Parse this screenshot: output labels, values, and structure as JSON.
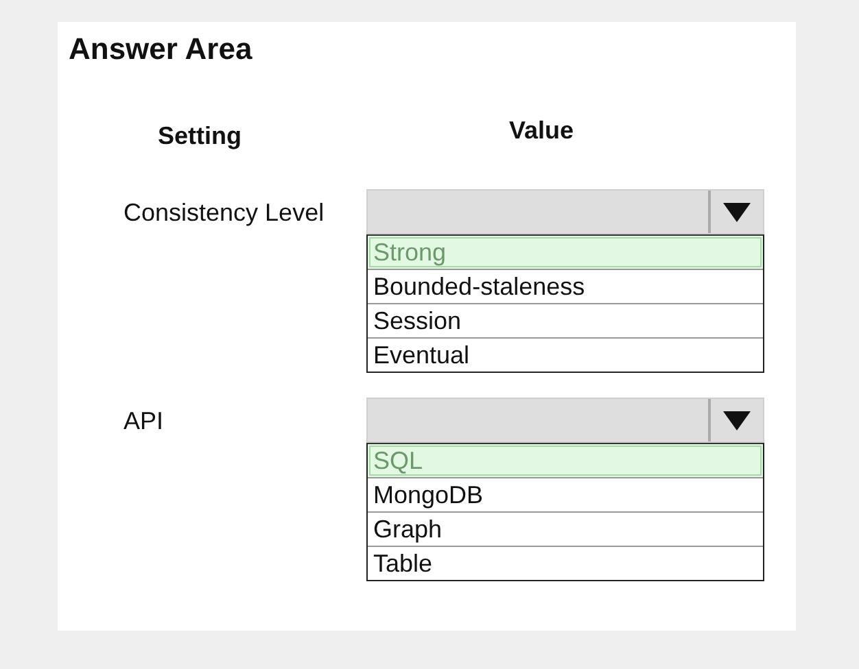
{
  "title": "Answer Area",
  "headers": {
    "setting": "Setting",
    "value": "Value"
  },
  "rows": [
    {
      "label": "Consistency Level",
      "options": [
        {
          "label": "Strong",
          "selected": true
        },
        {
          "label": "Bounded-staleness",
          "selected": false
        },
        {
          "label": "Session",
          "selected": false
        },
        {
          "label": "Eventual",
          "selected": false
        }
      ]
    },
    {
      "label": "API",
      "options": [
        {
          "label": "SQL",
          "selected": true
        },
        {
          "label": "MongoDB",
          "selected": false
        },
        {
          "label": "Graph",
          "selected": false
        },
        {
          "label": "Table",
          "selected": false
        }
      ]
    }
  ]
}
